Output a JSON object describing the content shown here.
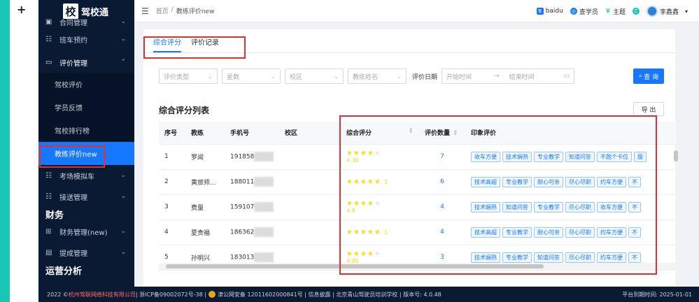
{
  "plus": "+",
  "logo": {
    "mark": "校",
    "text": "驾校通"
  },
  "sidebar": {
    "items_top": [
      {
        "icon": "▣",
        "label": "合同管理"
      },
      {
        "icon": "☷",
        "label": "班车预约"
      },
      {
        "icon": "▭",
        "label": "评价管理"
      }
    ],
    "sub_items": [
      {
        "label": "驾校评价"
      },
      {
        "label": "学员反馈"
      },
      {
        "label": "驾校排行榜"
      },
      {
        "label": "教练评价new"
      }
    ],
    "items_mid": [
      {
        "icon": "☷",
        "label": "考场模拟车"
      },
      {
        "icon": "☷",
        "label": "接送管理"
      }
    ],
    "group_finance": "财务",
    "items_fin": [
      {
        "icon": "⊞",
        "label": "财务管理(new)"
      },
      {
        "icon": "▤",
        "label": "提成管理"
      }
    ],
    "group_ops": "运营分析"
  },
  "topbar": {
    "fold_icon": "☰",
    "breadcrumb": [
      "首页",
      "/",
      "教练评价new"
    ],
    "right": [
      {
        "icon": "B",
        "label": "baidu",
        "color": "#1677ff"
      },
      {
        "icon": "◎",
        "label": "查学员",
        "color": "#1677ff"
      },
      {
        "icon": "♛",
        "label": "主题",
        "color": "#1cc6b6"
      },
      {
        "icon": "C",
        "label": "",
        "color": "#1cc6b6"
      }
    ],
    "user": "李鑫鑫",
    "caret": "▾"
  },
  "tabs": [
    "综合评分",
    "评价记录"
  ],
  "filters": {
    "type": "评价类型",
    "level": "星数",
    "campus": "校区",
    "coach": "教练姓名",
    "date_label": "评价日期",
    "start": "开始时间",
    "arrow": "→",
    "end": "结束时间",
    "search": "查 询"
  },
  "list_title": "综合评分列表",
  "export": "导 出",
  "table": {
    "headers": [
      "序号",
      "教练",
      "手机号",
      "校区",
      "综合评分",
      "评价数量",
      "印象评价"
    ],
    "sort_icon": "⇕",
    "rows": [
      {
        "no": "1",
        "coach": "罗闻",
        "phone": "191858",
        "campus": "",
        "stars": 4,
        "score": "4.30",
        "count": "7",
        "tags": [
          "收车方便",
          "技术娴熟",
          "专业教学",
          "知道问答",
          "不跑个卡位",
          "服"
        ]
      },
      {
        "no": "2",
        "coach": "黄旅师...",
        "phone": "188011",
        "campus": "",
        "stars": 5,
        "score": "5",
        "count": "6",
        "tags": [
          "技术高超",
          "专业教学",
          "耐心可亲",
          "尽心尽职",
          "约车方便",
          "不"
        ]
      },
      {
        "no": "3",
        "coach": "费量",
        "phone": "159107",
        "campus": "",
        "stars": 4,
        "score": "4.6",
        "count": "4",
        "tags": [
          "技术娴熟",
          "知道问答",
          "专业教学",
          "尽心尽职",
          "收车方便",
          "不"
        ]
      },
      {
        "no": "4",
        "coach": "夏贵福",
        "phone": "186362",
        "campus": "",
        "stars": 5,
        "score": "5",
        "count": "4",
        "tags": [
          "技术高超",
          "专业教学",
          "耐心可亲",
          "尽心尽职",
          "约车方便",
          "不"
        ]
      },
      {
        "no": "5",
        "coach": "孙明兴",
        "phone": "183013",
        "campus": "",
        "stars": 4,
        "score": "4.85",
        "count": "3",
        "tags": [
          "技术娴熟",
          "专业教学",
          "知道问答",
          "尽心尽职",
          "约车方便",
          "不"
        ]
      }
    ]
  },
  "footer": {
    "copyright": "2022 ©",
    "company": "杭州驾联网络科技有限公司",
    "rest": " | 浙ICP备09002072号-38 | ",
    "police": "津公网安备 12011602000841号 | 信息披露 | 北京青山驾驶员培训学校 | 版本号: 4.0.48",
    "expire": "平台到期时间: 2025-01-01"
  }
}
